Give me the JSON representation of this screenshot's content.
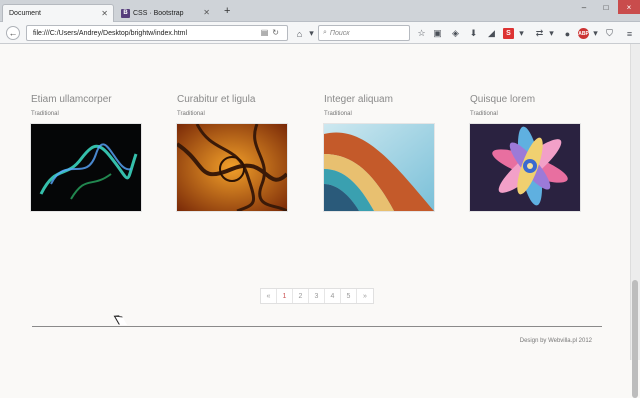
{
  "browser": {
    "tabs": [
      {
        "title": "Document",
        "active": true
      },
      {
        "title": "CSS · Bootstrap",
        "active": false,
        "favicon": "B"
      }
    ],
    "url": "file:///C:/Users/Andrey/Desktop/brightw/index.html",
    "search_placeholder": "Поиск",
    "win_minimize": "–",
    "win_maximize": "□",
    "win_close": "×",
    "new_tab": "+"
  },
  "gallery": {
    "cards": [
      {
        "title": "Etiam ullamcorper",
        "subtitle": "Traditional",
        "image": "smoke-icon"
      },
      {
        "title": "Curabitur et ligula",
        "subtitle": "Traditional",
        "image": "fractal-icon"
      },
      {
        "title": "Integer aliquam",
        "subtitle": "Traditional",
        "image": "waves-icon"
      },
      {
        "title": "Quisque lorem",
        "subtitle": "Traditional",
        "image": "flower-icon"
      }
    ]
  },
  "pagination": {
    "prev": "«",
    "pages": [
      "1",
      "2",
      "3",
      "4",
      "5"
    ],
    "active": "1",
    "next": "»"
  },
  "footer": {
    "credit": "Design by Webvilla.pl 2012"
  }
}
